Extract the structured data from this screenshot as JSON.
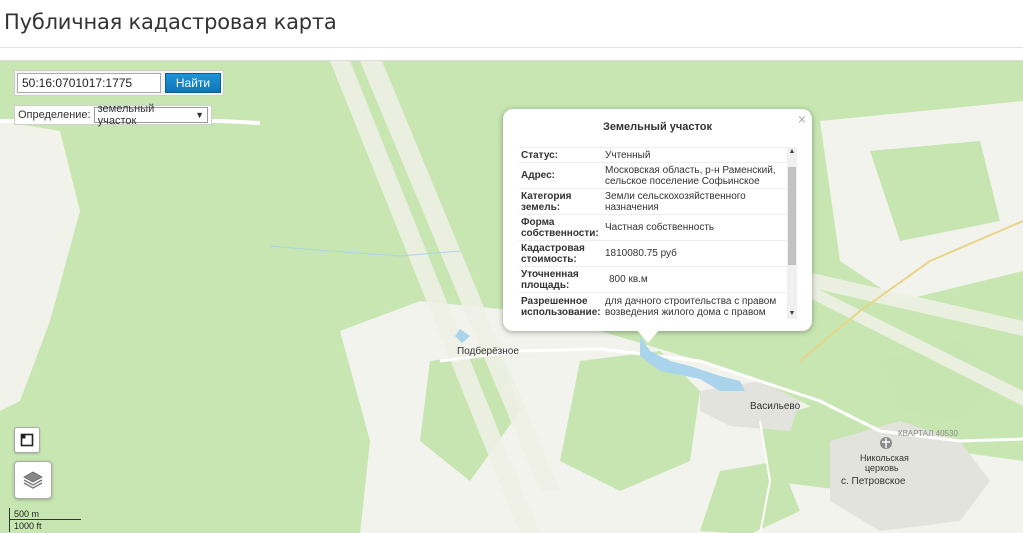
{
  "page": {
    "title": "Публичная кадастровая карта"
  },
  "search": {
    "value": "50:16:0701017:1775",
    "button_label": "Найти"
  },
  "definition": {
    "label": "Определение:",
    "selected": "земельный участок"
  },
  "map": {
    "labels": {
      "podberezhnoe": "Подберёзное",
      "vasilevo": "Васильево",
      "church": "Никольская",
      "church2": "церковь",
      "petrovskoe": "с. Петровское",
      "kvartal": "КВАРТАЛ 40530"
    },
    "scale": {
      "metric": "500 m",
      "imperial": "1000 ft"
    }
  },
  "popup": {
    "title": "Земельный участок",
    "rows": [
      {
        "label": "Статус:",
        "value": "Учтенный"
      },
      {
        "label": "Адрес:",
        "value": "Московская область, р-н Раменский, сельское поселение Софьинское"
      },
      {
        "label": "Категория земель:",
        "value": "Земли сельскохозяйственного назначения"
      },
      {
        "label": "Форма собственности:",
        "value": "Частная собственность"
      },
      {
        "label": "Кадастровая стоимость:",
        "value": "1810080.75 руб"
      },
      {
        "label": "Уточненная площадь:",
        "value": "800 кв.м"
      },
      {
        "label": "Разрешенное использование:",
        "value": "для дачного строительства с правом возведения жилого дома с правом"
      }
    ]
  },
  "colors": {
    "forest": "#c6e5b0",
    "field": "#f3f3ec",
    "water": "#a9d4ec",
    "road": "#ffffff",
    "button": "#1588cc"
  }
}
